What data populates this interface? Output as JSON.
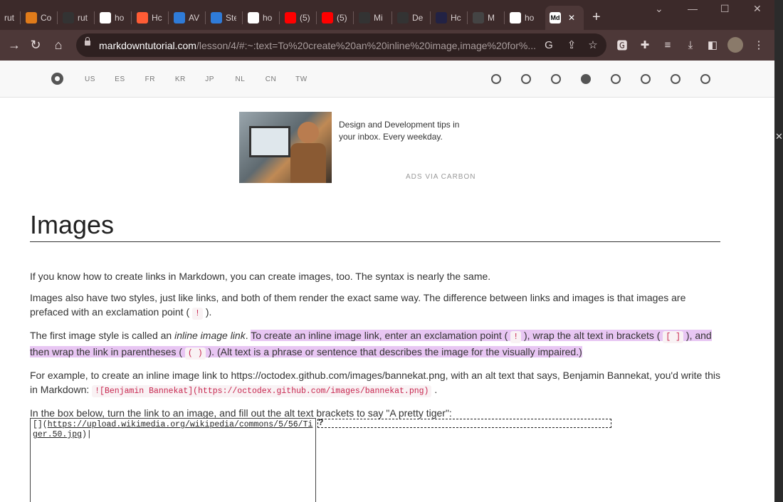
{
  "tabs": [
    {
      "title": "rut",
      "icon": "document-icon",
      "color": "#5a4646"
    },
    {
      "title": "Co",
      "icon": "copy-icon",
      "color": "#e07b1a"
    },
    {
      "title": "rut",
      "icon": "github-icon",
      "color": "#333333"
    },
    {
      "title": "ho",
      "icon": "google-icon",
      "color": "#ffffff"
    },
    {
      "title": "Hc",
      "icon": "hubspot-icon",
      "color": "#ff5c35"
    },
    {
      "title": "AV",
      "icon": "site-icon",
      "color": "#2f7bd8"
    },
    {
      "title": "Ste",
      "icon": "site-icon",
      "color": "#2f7bd8"
    },
    {
      "title": "ho",
      "icon": "google-icon",
      "color": "#ffffff"
    },
    {
      "title": "(5)",
      "icon": "youtube-icon",
      "color": "#ff0000"
    },
    {
      "title": "(5)",
      "icon": "youtube-icon",
      "color": "#ff0000"
    },
    {
      "title": "Mi",
      "icon": "github-icon",
      "color": "#333333"
    },
    {
      "title": "De",
      "icon": "github-icon",
      "color": "#333333"
    },
    {
      "title": "Hc",
      "icon": "logo-icon",
      "color": "#222244"
    },
    {
      "title": "M",
      "icon": "site-icon",
      "color": "#444444"
    },
    {
      "title": "ho",
      "icon": "google-icon",
      "color": "#ffffff"
    },
    {
      "title": "",
      "icon": "markdown-icon",
      "color": "#ffffff",
      "fav_text": "Md",
      "active": true
    }
  ],
  "browser": {
    "url_domain": "markdowntutorial.com",
    "url_rest": "/lesson/4/#:~:text=To%20create%20an%20inline%20image,image%20for%..."
  },
  "site_nav": {
    "languages": [
      "US",
      "ES",
      "FR",
      "KR",
      "JP",
      "NL",
      "CN",
      "TW"
    ],
    "lesson_dots": 8,
    "current_lesson": 4
  },
  "ad": {
    "text": "Design and Development tips in your inbox. Every weekday.",
    "via": "ADS VIA CARBON"
  },
  "lesson": {
    "title": "Images",
    "p1": "If you know how to create links in Markdown, you can create images, too. The syntax is nearly the same.",
    "p2_a": "Images also have two styles, just like links, and both of them render the exact same way. The difference between links and images is that images are prefaced with an exclamation point (",
    "p2_code": "!",
    "p2_b": ").",
    "p3_a": "The first image style is called an ",
    "p3_em": "inline image link",
    "p3_b": ". ",
    "p3_hl_a": "To create an inline image link, enter an exclamation point (",
    "p3_code1": "!",
    "p3_hl_b": "), wrap the alt text in brackets (",
    "p3_code2": "[ ]",
    "p3_hl_c": "), and then wrap the link in parentheses (",
    "p3_code3": "( )",
    "p3_hl_d": "). (Alt text is a phrase or sentence that describes the image for the visually impaired.)",
    "p4_a": "For example, to create an inline image link to https://octodex.github.com/images/bannekat.png, with an alt text that says, Benjamin Bannekat, you'd write this in Markdown: ",
    "p4_code": "![Benjamin Bannekat](https://octodex.github.com/images/bannekat.png)",
    "p4_b": ".",
    "p5": "In the box below, turn the link to an image, and fill out the alt text brackets to say \"A pretty tiger\":"
  },
  "exercise": {
    "editor_prefix": "[](",
    "editor_link": "https://upload.wikimedia.org/wikipedia/commons/5/56/Tiger.50.jpg",
    "editor_suffix": ")",
    "preview_text": "?"
  }
}
